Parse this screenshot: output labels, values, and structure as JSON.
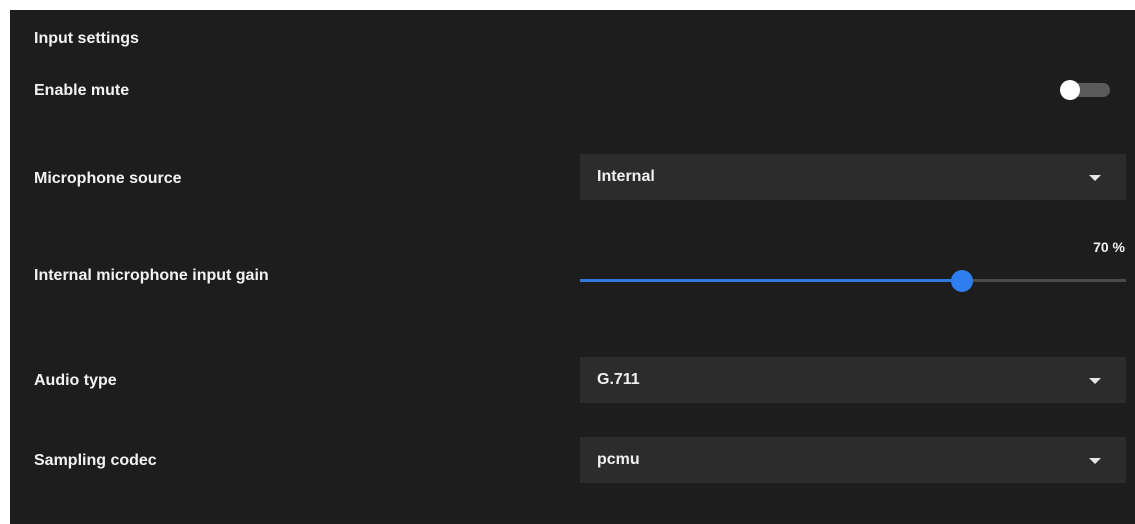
{
  "section": {
    "title": "Input settings"
  },
  "enable_mute": {
    "label": "Enable mute",
    "enabled": false
  },
  "microphone_source": {
    "label": "Microphone source",
    "value": "Internal"
  },
  "input_gain": {
    "label": "Internal microphone input gain",
    "value": 70,
    "display": "70 %"
  },
  "audio_type": {
    "label": "Audio type",
    "value": "G.711"
  },
  "sampling_codec": {
    "label": "Sampling codec",
    "value": "pcmu"
  },
  "colors": {
    "panel_background": "#1d1d1d",
    "field_background": "#2c2c2c",
    "accent": "#2f7ef0",
    "toggle_off_track": "#5a5a5a"
  },
  "icons": {
    "dropdown": "caret-down-icon"
  }
}
